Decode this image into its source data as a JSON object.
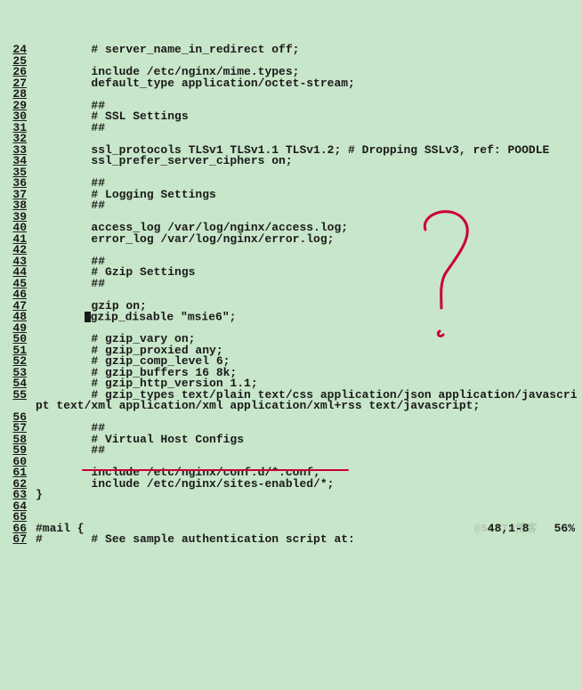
{
  "lines": [
    {
      "n": "24",
      "t": "        # server_name_in_redirect off;"
    },
    {
      "n": "25",
      "t": ""
    },
    {
      "n": "26",
      "t": "        include /etc/nginx/mime.types;"
    },
    {
      "n": "27",
      "t": "        default_type application/octet-stream;"
    },
    {
      "n": "28",
      "t": ""
    },
    {
      "n": "29",
      "t": "        ##"
    },
    {
      "n": "30",
      "t": "        # SSL Settings"
    },
    {
      "n": "31",
      "t": "        ##"
    },
    {
      "n": "32",
      "t": ""
    },
    {
      "n": "33",
      "t": "        ssl_protocols TLSv1 TLSv1.1 TLSv1.2; # Dropping SSLv3, ref: POODLE"
    },
    {
      "n": "34",
      "t": "        ssl_prefer_server_ciphers on;"
    },
    {
      "n": "35",
      "t": ""
    },
    {
      "n": "36",
      "t": "        ##"
    },
    {
      "n": "37",
      "t": "        # Logging Settings"
    },
    {
      "n": "38",
      "t": "        ##"
    },
    {
      "n": "39",
      "t": ""
    },
    {
      "n": "40",
      "t": "        access_log /var/log/nginx/access.log;"
    },
    {
      "n": "41",
      "t": "        error_log /var/log/nginx/error.log;"
    },
    {
      "n": "42",
      "t": ""
    },
    {
      "n": "43",
      "t": "        ##"
    },
    {
      "n": "44",
      "t": "        # Gzip Settings"
    },
    {
      "n": "45",
      "t": "        ##"
    },
    {
      "n": "46",
      "t": ""
    },
    {
      "n": "47",
      "t": "        gzip on;"
    },
    {
      "n": "48",
      "t": "",
      "cursor": true,
      "after": "gzip_disable \"msie6\";"
    },
    {
      "n": "49",
      "t": ""
    },
    {
      "n": "50",
      "t": "        # gzip_vary on;"
    },
    {
      "n": "51",
      "t": "        # gzip_proxied any;"
    },
    {
      "n": "52",
      "t": "        # gzip_comp_level 6;"
    },
    {
      "n": "53",
      "t": "        # gzip_buffers 16 8k;"
    },
    {
      "n": "54",
      "t": "        # gzip_http_version 1.1;"
    },
    {
      "n": "55",
      "t": "        # gzip_types text/plain text/css application/json application/javascript text/xml application/xml application/xml+rss text/javascript;",
      "wrap": true
    },
    {
      "n": "56",
      "t": ""
    },
    {
      "n": "57",
      "t": "        ##"
    },
    {
      "n": "58",
      "t": "        # Virtual Host Configs"
    },
    {
      "n": "59",
      "t": "        ##"
    },
    {
      "n": "60",
      "t": ""
    },
    {
      "n": "61",
      "t": "        include /etc/nginx/conf.d/*.conf;"
    },
    {
      "n": "62",
      "t": "        include /etc/nginx/sites-enabled/*;"
    },
    {
      "n": "63",
      "t": "}"
    },
    {
      "n": "64",
      "t": ""
    },
    {
      "n": "65",
      "t": ""
    },
    {
      "n": "66",
      "t": "#mail {"
    },
    {
      "n": "67",
      "t": "#       # See sample authentication script at:"
    }
  ],
  "status": {
    "pos": "48,1-8",
    "pct": "56%"
  },
  "watermark": "@51CTO博客",
  "annotations": {
    "underline_color": "#cc0033",
    "question_mark_color": "#cc0033"
  }
}
